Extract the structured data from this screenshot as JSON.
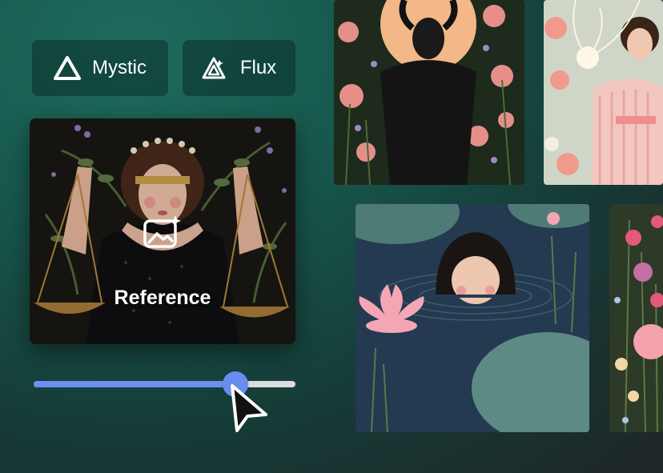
{
  "models": {
    "mystic_label": "Mystic",
    "flux_label": "Flux"
  },
  "reference": {
    "label": "Reference",
    "icon": "image-sparkle-icon"
  },
  "slider": {
    "value_fraction": 0.77,
    "fill_color": "#6d8ff2",
    "track_color": "#dcdcdc"
  },
  "gallery": {
    "tiles": [
      "demon-in-flowers",
      "woman-with-light-orb",
      "woman-in-lotus-pond",
      "flower-field"
    ]
  },
  "colors": {
    "background_top": "#1f6c5e",
    "background_bottom": "#1f2526",
    "button_bg": "#0a2d28"
  }
}
